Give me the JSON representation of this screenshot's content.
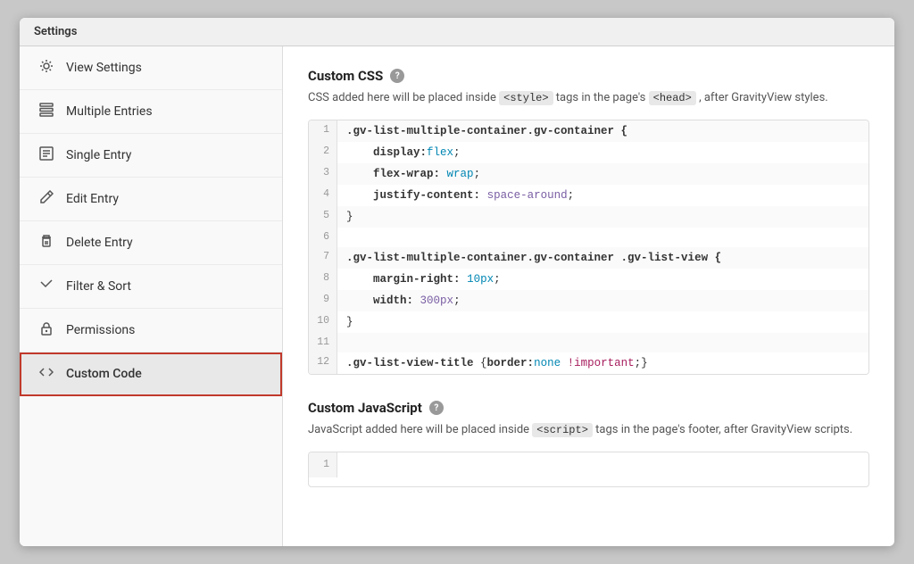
{
  "window": {
    "title": "Settings"
  },
  "sidebar": {
    "items": [
      {
        "id": "view-settings",
        "label": "View Settings",
        "icon": "⚙",
        "active": false
      },
      {
        "id": "multiple-entries",
        "label": "Multiple Entries",
        "icon": "▤",
        "active": false
      },
      {
        "id": "single-entry",
        "label": "Single Entry",
        "icon": "▣",
        "active": false
      },
      {
        "id": "edit-entry",
        "label": "Edit Entry",
        "icon": "✎",
        "active": false
      },
      {
        "id": "delete-entry",
        "label": "Delete Entry",
        "icon": "🗑",
        "active": false
      },
      {
        "id": "filter-sort",
        "label": "Filter & Sort",
        "icon": "▼",
        "active": false
      },
      {
        "id": "permissions",
        "label": "Permissions",
        "icon": "🔒",
        "active": false
      },
      {
        "id": "custom-code",
        "label": "Custom Code",
        "icon": "<>",
        "active": true
      }
    ]
  },
  "main": {
    "custom_css": {
      "title": "Custom CSS",
      "description_start": "CSS added here will be placed inside",
      "style_tag": "<style>",
      "description_middle": "tags in the page's",
      "head_tag": "<head>",
      "description_end": ", after GravityView styles.",
      "lines": [
        {
          "num": 1,
          "content": ".gv-list-multiple-container.gv-container {"
        },
        {
          "num": 2,
          "content": "    display:flex;"
        },
        {
          "num": 3,
          "content": "    flex-wrap: wrap;"
        },
        {
          "num": 4,
          "content": "    justify-content: space-around;"
        },
        {
          "num": 5,
          "content": "}"
        },
        {
          "num": 6,
          "content": ""
        },
        {
          "num": 7,
          "content": ".gv-list-multiple-container.gv-container .gv-list-view {"
        },
        {
          "num": 8,
          "content": "    margin-right: 10px;"
        },
        {
          "num": 9,
          "content": "    width: 300px;"
        },
        {
          "num": 10,
          "content": "}"
        },
        {
          "num": 11,
          "content": ""
        },
        {
          "num": 12,
          "content": ".gv-list-view-title {border:none !important;}"
        }
      ]
    },
    "custom_js": {
      "title": "Custom JavaScript",
      "description_start": "JavaScript added here will be placed inside",
      "script_tag": "<script>",
      "description_end": "tags in the page's footer, after GravityView scripts.",
      "lines": [
        {
          "num": 1,
          "content": ""
        }
      ]
    }
  }
}
